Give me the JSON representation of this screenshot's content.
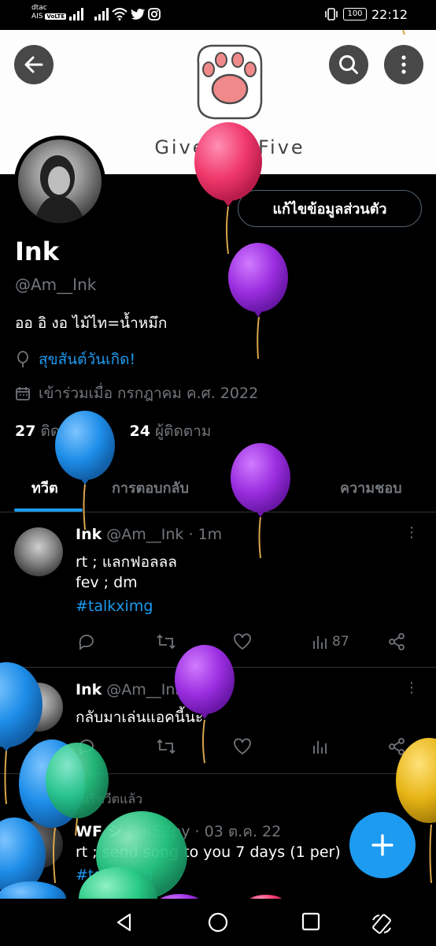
{
  "status_bar": {
    "carrier1": "dtac",
    "carrier2": "AIS",
    "volte": "VoLTE",
    "battery": "100",
    "time": "22:12"
  },
  "banner": {
    "text": "Give me Five"
  },
  "profile": {
    "edit_label": "แก้ไขข้อมูลส่วนตัว",
    "display_name": "Ink",
    "handle": "@Am__Ink",
    "bio": "ออ อิ งอ ไม้ไท=น้ำหมึก",
    "birthday": "สุขสันต์วันเกิด!",
    "joined": "เข้าร่วมเมื่อ กรกฎาคม ค.ศ. 2022",
    "following_count": "27",
    "following_label": "ติดตามอยู่",
    "followers_count": "24",
    "followers_label": "ผู้ติดตาม"
  },
  "tabs": [
    {
      "label": "ทวีต"
    },
    {
      "label": "การตอบกลับ"
    },
    {
      "label": "สื่อ"
    },
    {
      "label": "ความชอบ"
    }
  ],
  "tweets": [
    {
      "name": "Ink",
      "handle": "@Am__Ink",
      "time": "1m",
      "lines": [
        "rt ; แลกฟอลลล",
        "fev ; dm"
      ],
      "hashtag": "#talkximg",
      "views": "87"
    },
    {
      "name": "Ink",
      "handle": "@Am__Ink",
      "time": "2m",
      "lines": [
        "กลับมาเล่นแอคนี้นะ"
      ],
      "views": ""
    }
  ],
  "retweet": {
    "label": "คุณรีทวีตแล้ว",
    "name": "WF シ",
    "handle": "@K5Zpy",
    "time": "03 ต.ค. 22",
    "line": "rt ; send song to you 7 days (1 per)",
    "hashtag": "#talkximg"
  },
  "colors": {
    "accent": "#1d9bf0",
    "background": "#000000",
    "muted": "#71767b",
    "divider": "#2f3336"
  }
}
